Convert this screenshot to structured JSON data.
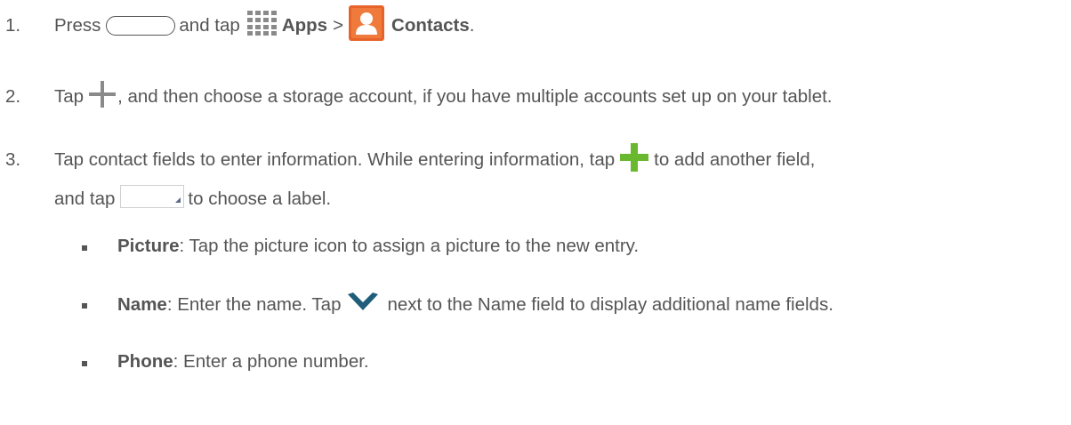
{
  "steps": [
    {
      "number": "1.",
      "press": "Press",
      "and_tap": "and tap",
      "apps": "Apps",
      "sep": ">",
      "contacts": "Contacts",
      "period": "."
    },
    {
      "number": "2.",
      "tap": "Tap",
      "rest": ", and then choose a storage account, if you have multiple accounts set up on your tablet."
    },
    {
      "number": "3.",
      "line1_a": "Tap contact fields to enter information. While entering information, tap",
      "line1_b": "to add another field,",
      "line2_a": "and tap",
      "line2_b": "to choose a label."
    }
  ],
  "bullets": [
    {
      "term": "Picture",
      "text": ": Tap the picture icon to assign a picture to the new entry."
    },
    {
      "term": "Name",
      "text_a": ": Enter the name. Tap",
      "text_b": "next to the Name field to display additional name fields."
    },
    {
      "term": "Phone",
      "text": ": Enter a phone number."
    }
  ],
  "icons": {
    "home": "home-button-icon",
    "apps": "apps-grid-icon",
    "contacts": "contacts-icon",
    "add_gray": "plus-icon",
    "add_green": "add-field-icon",
    "label": "label-dropdown-icon",
    "expand": "chevron-down-icon"
  },
  "colors": {
    "text": "#555555",
    "contacts_icon": "#e8632a",
    "add_green": "#6ab82e",
    "chevron": "#1f5d7a",
    "apps_icon": "#8a8a8a"
  }
}
